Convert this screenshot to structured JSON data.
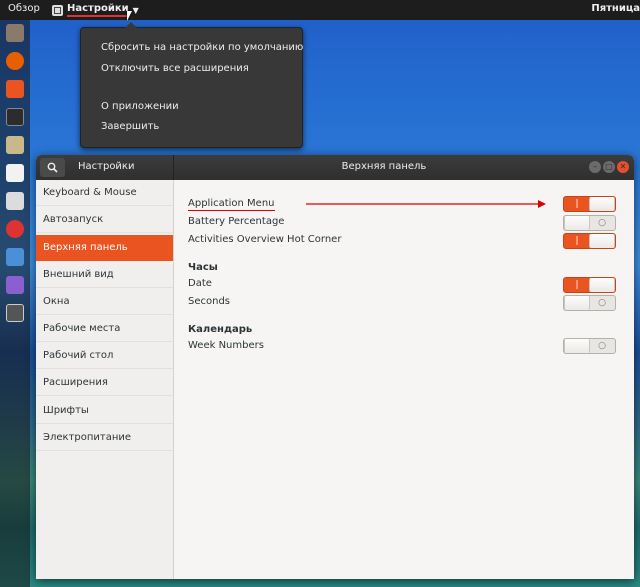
{
  "topbar": {
    "activities": "Обзор",
    "app_name": "Настройки",
    "clock": "Пятница"
  },
  "app_menu": {
    "items": [
      "Сбросить на настройки по умолчанию",
      "Отключить все расширения",
      "О приложении",
      "Завершить"
    ]
  },
  "window": {
    "left_title": "Настройки",
    "title": "Верхняя панель"
  },
  "sidebar": {
    "items": [
      {
        "label": "Keyboard & Mouse",
        "active": false
      },
      {
        "label": "Автозапуск",
        "active": false
      },
      {
        "label": "Верхняя панель",
        "active": true
      },
      {
        "label": "Внешний вид",
        "active": false
      },
      {
        "label": "Окна",
        "active": false
      },
      {
        "label": "Рабочие места",
        "active": false
      },
      {
        "label": "Рабочий стол",
        "active": false
      },
      {
        "label": "Расширения",
        "active": false
      },
      {
        "label": "Шрифты",
        "active": false
      },
      {
        "label": "Электропитание",
        "active": false
      }
    ]
  },
  "content": {
    "rows": [
      {
        "label": "Application Menu",
        "on": true
      },
      {
        "label": "Battery Percentage",
        "on": false
      },
      {
        "label": "Activities Overview Hot Corner",
        "on": true
      }
    ],
    "clock_section": "Часы",
    "clock_rows": [
      {
        "label": "Date",
        "on": true
      },
      {
        "label": "Seconds",
        "on": false
      }
    ],
    "calendar_section": "Календарь",
    "calendar_rows": [
      {
        "label": "Week Numbers",
        "on": false
      }
    ]
  },
  "switch_symbols": {
    "on": "|",
    "off": "○"
  },
  "colors": {
    "accent": "#e95420",
    "annotation": "#d00000"
  }
}
